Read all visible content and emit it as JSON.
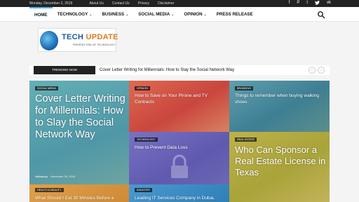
{
  "topbar": {
    "date": "Monday, December 2, 2019",
    "links": [
      "About Us",
      "Contact Us",
      "Privacy",
      "Disclaimer"
    ],
    "social": [
      "facebook-icon",
      "pinterest-icon",
      "tumblr-icon",
      "twitter-icon",
      "vk-icon"
    ]
  },
  "nav": {
    "items": [
      {
        "label": "HOME",
        "dropdown": false,
        "active": true
      },
      {
        "label": "TECHNOLOGY",
        "dropdown": true
      },
      {
        "label": "BUSINESS",
        "dropdown": true
      },
      {
        "label": "SOCIAL MEDIA",
        "dropdown": true
      },
      {
        "label": "OPINION",
        "dropdown": true
      },
      {
        "label": "PRESS RELEASE",
        "dropdown": false
      }
    ]
  },
  "logo": {
    "word1": "TECH",
    "word2": "UPDATE",
    "tagline": "PRESENT ERA OF TECHNOLOGY"
  },
  "trending": {
    "badge": "TRENDING NOW",
    "headline": "Cover Letter Writing for Millennials: How to Slay the Social Network Way",
    "prev": "‹",
    "next": "›"
  },
  "tiles": [
    {
      "category": "SOCIAL MEDIA",
      "title": "Cover Letter Writing for Millennials: How to Slay the Social Network Way",
      "author": "Aldoucey",
      "date": "November 30, 2019",
      "bg": "#5aa5b0"
    },
    {
      "category": "OPINION",
      "title": "How to Save on Your Phone and TV Contracts",
      "bg": "#d85a4a"
    },
    {
      "category": "BRANDING",
      "title": "Things to remember when buying walking shoes",
      "bg": "#4c8fa0"
    },
    {
      "category": "TECHNOLOGY",
      "title": "How to Prevent Data Loss",
      "bg": "#6a66b8"
    },
    {
      "category": "REAL ESTATE",
      "title": "Who Can Sponsor a Real Estate License in Texas",
      "bg": "#b4a83a"
    },
    {
      "category": "HEALTH & BEAUTY",
      "title": "What Should I Eat 30 Minutes Before a",
      "bg": "#d89a3c"
    },
    {
      "category": "INDUSTRY",
      "title": "Leading IT Services Company in Dubai,",
      "bg": "#3c8fc4"
    }
  ]
}
